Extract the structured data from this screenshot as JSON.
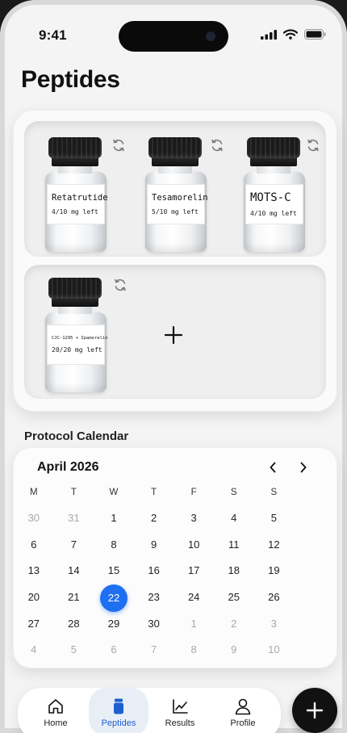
{
  "status_bar": {
    "time": "9:41"
  },
  "page": {
    "title": "Peptides"
  },
  "vials": [
    {
      "name": "Retatrutide",
      "remaining": "4/10 mg left"
    },
    {
      "name": "Tesamorelin",
      "remaining": "5/10 mg left"
    },
    {
      "name": "MOTS-C",
      "remaining": "4/10 mg left"
    },
    {
      "name": "CJC-1295 + Ipamorelin",
      "remaining": "20/20 mg left"
    }
  ],
  "calendar": {
    "section_title": "Protocol Calendar",
    "month_label": "April 2026",
    "weekdays": [
      "M",
      "T",
      "W",
      "T",
      "F",
      "S",
      "S"
    ],
    "weeks": [
      [
        "30",
        "31",
        "1",
        "2",
        "3",
        "4",
        "5"
      ],
      [
        "6",
        "7",
        "8",
        "9",
        "10",
        "11",
        "12"
      ],
      [
        "13",
        "14",
        "15",
        "16",
        "17",
        "18",
        "19"
      ],
      [
        "20",
        "21",
        "22",
        "23",
        "24",
        "25",
        "26"
      ],
      [
        "27",
        "28",
        "29",
        "30",
        "1",
        "2",
        "3"
      ],
      [
        "4",
        "5",
        "6",
        "7",
        "8",
        "9",
        "10"
      ]
    ],
    "selected_day": "22",
    "accent_color": "#1e6ff2"
  },
  "tabbar": {
    "tabs": [
      {
        "label": "Home",
        "icon": "home-icon"
      },
      {
        "label": "Peptides",
        "icon": "vial-icon",
        "active": true
      },
      {
        "label": "Results",
        "icon": "chart-icon"
      },
      {
        "label": "Profile",
        "icon": "person-icon"
      }
    ],
    "fab_icon": "plus-icon"
  }
}
